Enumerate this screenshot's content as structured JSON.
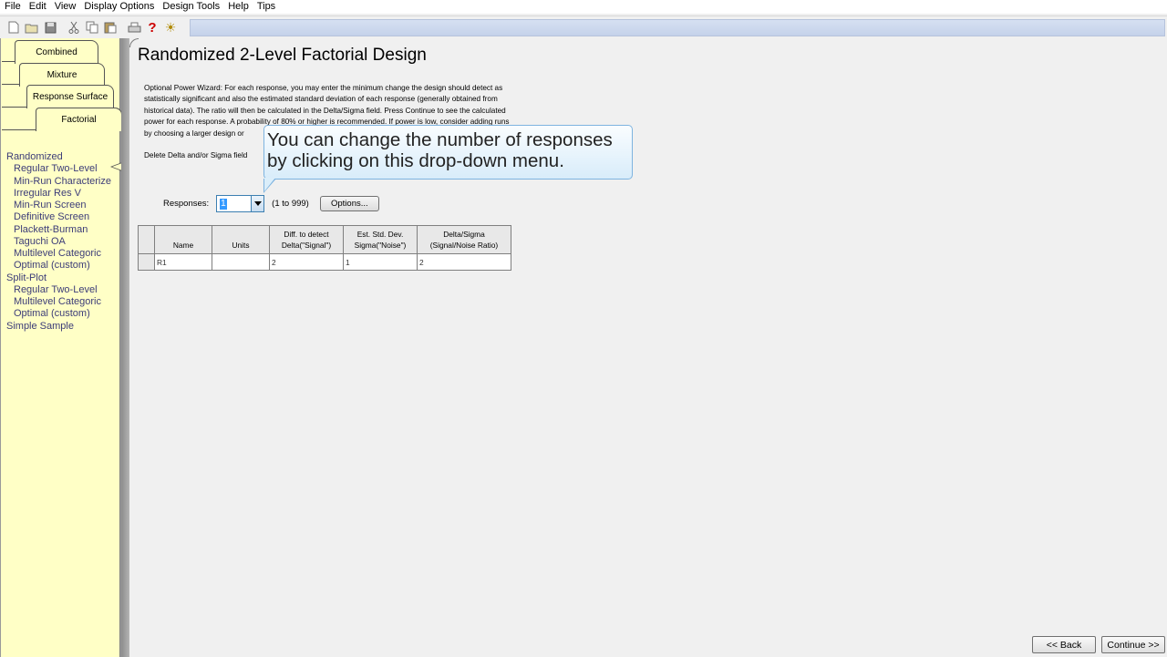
{
  "menu": [
    "File",
    "Edit",
    "View",
    "Display Options",
    "Design Tools",
    "Help",
    "Tips"
  ],
  "toolbar": {
    "icons": [
      "new-file-icon",
      "open-folder-icon",
      "save-icon",
      "cut-icon",
      "copy-icon",
      "paste-icon",
      "print-icon",
      "help-icon",
      "tip-bulb-icon"
    ],
    "help_glyph": "?",
    "bulb_glyph": "☀"
  },
  "tabs": [
    "Combined",
    "Mixture",
    "Response Surface",
    "Factorial"
  ],
  "nav": [
    {
      "label": "Randomized",
      "sub": false
    },
    {
      "label": "Regular Two-Level",
      "sub": true
    },
    {
      "label": "Min-Run Characterize",
      "sub": true
    },
    {
      "label": "Irregular Res V",
      "sub": true
    },
    {
      "label": "Min-Run Screen",
      "sub": true
    },
    {
      "label": "Definitive Screen",
      "sub": true
    },
    {
      "label": "Plackett-Burman",
      "sub": true
    },
    {
      "label": "Taguchi OA",
      "sub": true
    },
    {
      "label": "Multilevel Categoric",
      "sub": true
    },
    {
      "label": "Optimal (custom)",
      "sub": true
    },
    {
      "label": "Split-Plot",
      "sub": false
    },
    {
      "label": "Regular Two-Level",
      "sub": true
    },
    {
      "label": "Multilevel Categoric",
      "sub": true
    },
    {
      "label": "Optimal (custom)",
      "sub": true
    },
    {
      "label": "Simple Sample",
      "sub": false
    }
  ],
  "main": {
    "title": "Randomized 2-Level Factorial Design",
    "desc_lines": [
      "Optional Power Wizard: For each response, you may enter the minimum change the design should detect as",
      "statistically significant and also the estimated standard deviation of each response (generally obtained from",
      "historical data). The ratio will then be calculated in the Delta/Sigma field. Press Continue to see the calculated",
      "power for each response. A probability of 80% or higher is recommended. If power is low, consider adding runs",
      "by choosing a larger design or"
    ],
    "delete_note": "Delete Delta and/or Sigma field",
    "responses_label": "Responses:",
    "responses_value": "1",
    "responses_range": "(1 to 999)",
    "options_label": "Options..."
  },
  "grid": {
    "headers": [
      {
        "line1": "",
        "line2": "Name"
      },
      {
        "line1": "",
        "line2": "Units"
      },
      {
        "line1": "Diff. to detect",
        "line2": "Delta(\"Signal\")"
      },
      {
        "line1": "Est. Std. Dev.",
        "line2": "Sigma(\"Noise\")"
      },
      {
        "line1": "Delta/Sigma",
        "line2": "(Signal/Noise Ratio)"
      }
    ],
    "rows": [
      [
        "R1",
        "",
        "2",
        "1",
        "2"
      ]
    ]
  },
  "callout": {
    "line1": "You can change the number of responses",
    "line2": "by clicking on this drop-down menu."
  },
  "buttons": {
    "back": "<< Back",
    "continue": "Continue >>"
  }
}
